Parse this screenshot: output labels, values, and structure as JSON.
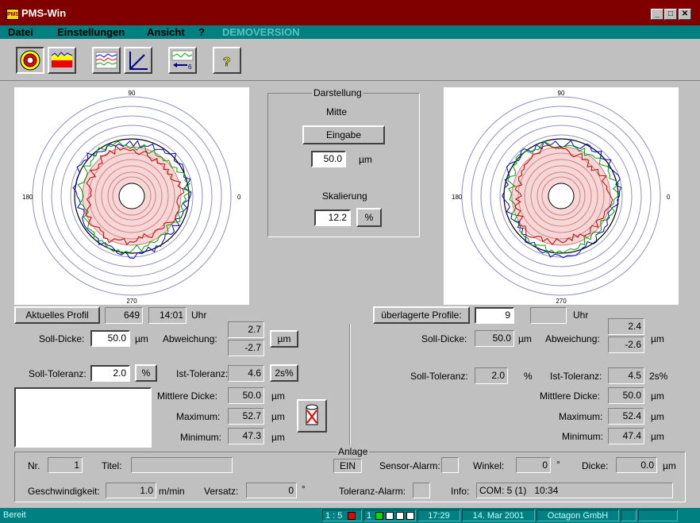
{
  "window": {
    "title": "PMS-Win",
    "app_icon_text": "PMS"
  },
  "menu": {
    "items": [
      "Datei",
      "Einstellungen",
      "Ansicht",
      "?"
    ],
    "demo_label": "DEMOVERSION"
  },
  "chart_data": [
    {
      "type": "polar",
      "title": "",
      "angle_labels": {
        "top": "90",
        "left": "180",
        "right": "0",
        "bottom": "270"
      },
      "series": [
        {
          "color": "#0000c8"
        },
        {
          "color": "#00a000"
        },
        {
          "color": "#c00000"
        }
      ]
    },
    {
      "type": "polar",
      "title": "",
      "angle_labels": {
        "top": "90",
        "left": "180",
        "right": "0",
        "bottom": "270"
      },
      "series": [
        {
          "color": "#0000c8"
        },
        {
          "color": "#00a000"
        },
        {
          "color": "#c00000"
        }
      ]
    }
  ],
  "darstellung": {
    "group_label": "Darstellung",
    "mitte_label": "Mitte",
    "eingabe_button": "Eingabe",
    "mitte_value": "50.0",
    "mitte_unit": "µm",
    "skalierung_label": "Skalierung",
    "skalierung_value": "12.2",
    "skalierung_unit": "%"
  },
  "left": {
    "profile_button": "Aktuelles Profil",
    "profile_nr": "649",
    "time": "14:01",
    "time_unit": "Uhr",
    "soll_dicke_label": "Soll-Dicke:",
    "soll_dicke_value": "50.0",
    "soll_dicke_unit": "µm",
    "abweichung_label": "Abweichung:",
    "abweichung_plus": "2.7",
    "abweichung_minus": "-2.7",
    "abweichung_unit": "µm",
    "soll_toleranz_label": "Soll-Toleranz:",
    "soll_toleranz_value": "2.0",
    "soll_toleranz_unit": "%",
    "ist_toleranz_label": "Ist-Toleranz:",
    "ist_toleranz_value": "4.6",
    "ist_toleranz_unit": "2s%",
    "mittlere_label": "Mittlere Dicke:",
    "mittlere_value": "50.0",
    "mittlere_unit": "µm",
    "maximum_label": "Maximum:",
    "maximum_value": "52.7",
    "maximum_unit": "µm",
    "minimum_label": "Minimum:",
    "minimum_value": "47.3",
    "minimum_unit": "µm"
  },
  "right": {
    "profile_button": "überlagerte Profile:",
    "profile_count": "9",
    "time": "",
    "time_unit": "Uhr",
    "soll_dicke_label": "Soll-Dicke:",
    "soll_dicke_value": "50.0",
    "soll_dicke_unit": "µm",
    "abweichung_label": "Abweichung:",
    "abweichung_plus": "2.4",
    "abweichung_minus": "-2.6",
    "abweichung_unit": "µm",
    "soll_toleranz_label": "Soll-Toleranz:",
    "soll_toleranz_value": "2.0",
    "soll_toleranz_unit": "%",
    "ist_toleranz_label": "Ist-Toleranz:",
    "ist_toleranz_value": "4.5",
    "ist_toleranz_unit": "2s%",
    "mittlere_label": "Mittlere Dicke:",
    "mittlere_value": "50.0",
    "mittlere_unit": "µm",
    "maximum_label": "Maximum:",
    "maximum_value": "52.4",
    "maximum_unit": "µm",
    "minimum_label": "Minimum:",
    "minimum_value": "47.4",
    "minimum_unit": "µm"
  },
  "anlage": {
    "group_label": "Anlage",
    "nr_label": "Nr.",
    "nr_value": "1",
    "titel_label": "Titel:",
    "titel_value": "",
    "ein_label": "EIN",
    "sensor_alarm_label": "Sensor-Alarm:",
    "winkel_label": "Winkel:",
    "winkel_value": "0",
    "winkel_unit": "°",
    "dicke_label": "Dicke:",
    "dicke_value": "0.0",
    "dicke_unit": "µm",
    "geschwindigkeit_label": "Geschwindigkeit:",
    "geschwindigkeit_value": "1.0",
    "geschwindigkeit_unit": "m/min",
    "versatz_label": "Versatz:",
    "versatz_value": "0",
    "versatz_unit": "°",
    "toleranz_alarm_label": "Toleranz-Alarm:",
    "info_label": "Info:",
    "info_value": "COM: 5 (1)   10:34"
  },
  "status": {
    "text": "Bereit",
    "ratio": "1 : 5",
    "channel": "1",
    "time": "17:29",
    "date": "14. Mar 2001",
    "company": "Octagon GmbH"
  }
}
